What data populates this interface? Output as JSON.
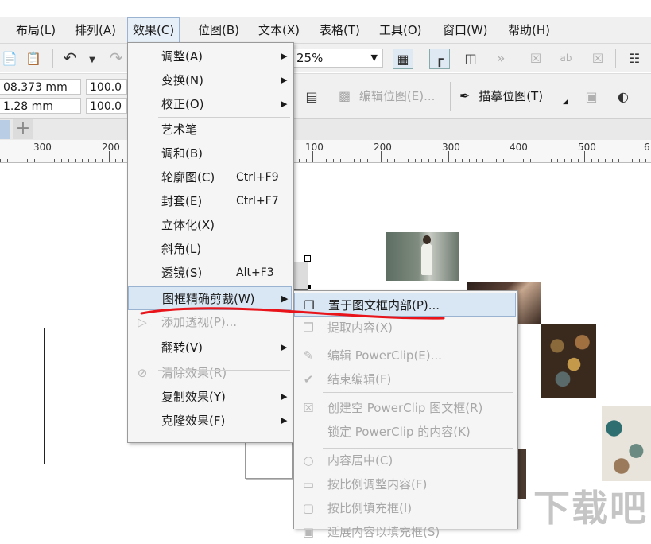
{
  "menubar": [
    "布局(L)",
    "排列(A)",
    "效果(C)",
    "位图(B)",
    "文本(X)",
    "表格(T)",
    "工具(O)",
    "窗口(W)",
    "帮助(H)"
  ],
  "toolbar": {
    "zoom": "25%",
    "icons": [
      "paste-icon",
      "undo-icon",
      "redo-icon",
      "snap-icon",
      "view-icon",
      "chevron-more-icon"
    ]
  },
  "propbar": {
    "x_value": "08.373 mm",
    "y_value": "1.28 mm",
    "scale_w": "100.0",
    "scale_h": "100.0",
    "edit_bitmap": "编辑位图(E)...",
    "trace_bitmap": "描摹位图(T)"
  },
  "tabs": {
    "add": "+"
  },
  "ruler": {
    "labels": [
      "300",
      "200",
      "100",
      "200",
      "300",
      "400",
      "500",
      "6"
    ]
  },
  "effects_menu": {
    "items": [
      {
        "label": "调整(A)",
        "shortcut": "",
        "submenu": true,
        "disabled": false
      },
      {
        "label": "变换(N)",
        "shortcut": "",
        "submenu": true,
        "disabled": false
      },
      {
        "label": "校正(O)",
        "shortcut": "",
        "submenu": true,
        "disabled": false
      },
      {
        "label": "艺术笔",
        "shortcut": "",
        "submenu": false,
        "disabled": false
      },
      {
        "label": "调和(B)",
        "shortcut": "",
        "submenu": false,
        "disabled": false
      },
      {
        "label": "轮廓图(C)",
        "shortcut": "Ctrl+F9",
        "submenu": false,
        "disabled": false
      },
      {
        "label": "封套(E)",
        "shortcut": "Ctrl+F7",
        "submenu": false,
        "disabled": false
      },
      {
        "label": "立体化(X)",
        "shortcut": "",
        "submenu": false,
        "disabled": false
      },
      {
        "label": "斜角(L)",
        "shortcut": "",
        "submenu": false,
        "disabled": false
      },
      {
        "label": "透镜(S)",
        "shortcut": "Alt+F3",
        "submenu": false,
        "disabled": false
      },
      {
        "label": "图框精确剪裁(W)",
        "shortcut": "",
        "submenu": true,
        "disabled": false
      },
      {
        "label": "添加透视(P)...",
        "shortcut": "",
        "submenu": false,
        "disabled": true
      },
      {
        "label": "翻转(V)",
        "shortcut": "",
        "submenu": true,
        "disabled": false
      },
      {
        "label": "清除效果(R)",
        "shortcut": "",
        "submenu": false,
        "disabled": true
      },
      {
        "label": "复制效果(Y)",
        "shortcut": "",
        "submenu": true,
        "disabled": false
      },
      {
        "label": "克隆效果(F)",
        "shortcut": "",
        "submenu": true,
        "disabled": false
      }
    ]
  },
  "powerclip_menu": {
    "items": [
      {
        "label": "置于图文框内部(P)...",
        "disabled": false
      },
      {
        "label": "提取内容(X)",
        "disabled": true
      },
      {
        "label": "编辑 PowerClip(E)...",
        "disabled": true
      },
      {
        "label": "结束编辑(F)",
        "disabled": true
      },
      {
        "label": "创建空 PowerClip 图文框(R)",
        "disabled": true
      },
      {
        "label": "锁定 PowerClip 的内容(K)",
        "disabled": true
      },
      {
        "label": "内容居中(C)",
        "disabled": true
      },
      {
        "label": "按比例调整内容(F)",
        "disabled": true
      },
      {
        "label": "按比例填充框(I)",
        "disabled": true
      },
      {
        "label": "延展内容以填充框(S)",
        "disabled": true
      }
    ]
  },
  "colors": {
    "annotation": "#e8141a",
    "highlight": "#d9e6f4"
  },
  "watermark": "下载吧"
}
